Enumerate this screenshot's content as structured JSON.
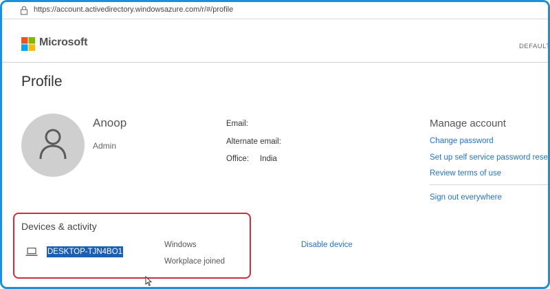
{
  "browser": {
    "url": "https://account.activedirectory.windowsazure.com/r/#/profile"
  },
  "header": {
    "brand": "Microsoft",
    "tenant_label": "DEFAULT I"
  },
  "page": {
    "title": "Profile"
  },
  "user": {
    "name": "Anoop",
    "role": "Admin"
  },
  "fields": {
    "email_label": "Email:",
    "email_value": "",
    "alt_email_label": "Alternate email:",
    "alt_email_value": "",
    "office_label": "Office:",
    "office_value": "India"
  },
  "manage": {
    "title": "Manage account",
    "links": {
      "change_password": "Change password",
      "self_service": "Set up self service password reset",
      "terms": "Review terms of use",
      "sign_out": "Sign out everywhere"
    }
  },
  "devices": {
    "title": "Devices & activity",
    "item": {
      "name": "DESKTOP-TJN4BO1",
      "os": "Windows",
      "join_type": "Workplace joined",
      "action": "Disable device"
    }
  },
  "colors": {
    "frame": "#1e90d8",
    "link": "#2672c0",
    "highlight_box": "#cf2b3b",
    "selection": "#1a5fb4",
    "logo": [
      "#f25022",
      "#7fba00",
      "#00a4ef",
      "#ffb900"
    ]
  }
}
